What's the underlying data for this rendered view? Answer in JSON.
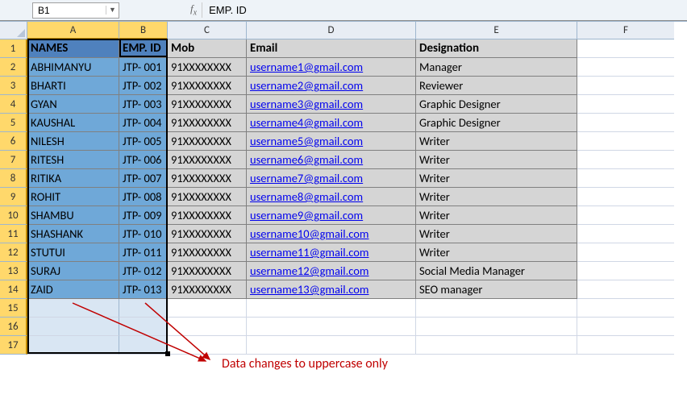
{
  "nameBox": "B1",
  "formulaValue": "EMP. ID",
  "columns": [
    "A",
    "B",
    "C",
    "D",
    "E",
    "F"
  ],
  "headerRow": {
    "A": "NAMES",
    "B": "EMP. ID",
    "C": "Mob",
    "D": "Email",
    "E": "Designation"
  },
  "rows": [
    {
      "n": 2,
      "a": "ABHIMANYU",
      "b": "JTP- 001",
      "c": "91XXXXXXXX",
      "d": "username1@gmail.com",
      "e": "Manager"
    },
    {
      "n": 3,
      "a": "BHARTI",
      "b": "JTP- 002",
      "c": "91XXXXXXXX",
      "d": "username2@gmail.com",
      "e": "Reviewer"
    },
    {
      "n": 4,
      "a": "GYAN",
      "b": "JTP- 003",
      "c": "91XXXXXXXX",
      "d": "username3@gmail.com",
      "e": "Graphic Designer"
    },
    {
      "n": 5,
      "a": "KAUSHAL",
      "b": "JTP- 004",
      "c": "91XXXXXXXX",
      "d": "username4@gmail.com",
      "e": "Graphic Designer"
    },
    {
      "n": 6,
      "a": "NILESH",
      "b": "JTP- 005",
      "c": "91XXXXXXXX",
      "d": "username5@gmail.com",
      "e": "Writer"
    },
    {
      "n": 7,
      "a": "RITESH",
      "b": "JTP- 006",
      "c": "91XXXXXXXX",
      "d": "username6@gmail.com",
      "e": "Writer"
    },
    {
      "n": 8,
      "a": "RITIKA",
      "b": "JTP- 007",
      "c": "91XXXXXXXX",
      "d": "username7@gmail.com",
      "e": "Writer"
    },
    {
      "n": 9,
      "a": "ROHIT",
      "b": "JTP- 008",
      "c": "91XXXXXXXX",
      "d": "username8@gmail.com",
      "e": "Writer"
    },
    {
      "n": 10,
      "a": "SHAMBU",
      "b": "JTP- 009",
      "c": "91XXXXXXXX",
      "d": "username9@gmail.com",
      "e": "Writer"
    },
    {
      "n": 11,
      "a": "SHASHANK",
      "b": "JTP- 010",
      "c": "91XXXXXXXX",
      "d": "username10@gmail.com",
      "e": "Writer"
    },
    {
      "n": 12,
      "a": "STUTUI",
      "b": "JTP- 011",
      "c": "91XXXXXXXX",
      "d": "username11@gmail.com",
      "e": "Writer"
    },
    {
      "n": 13,
      "a": "SURAJ",
      "b": "JTP- 012",
      "c": "91XXXXXXXX",
      "d": "username12@gmail.com",
      "e": "Social Media Manager"
    },
    {
      "n": 14,
      "a": "ZAID",
      "b": "JTP- 013",
      "c": "91XXXXXXXX",
      "d": "username13@gmail.com",
      "e": "SEO manager"
    }
  ],
  "emptyRows": [
    15,
    16,
    17
  ],
  "annotationText": "Data changes to uppercase only",
  "chart_data": {
    "type": "table",
    "title": "",
    "columns": [
      "NAMES",
      "EMP. ID",
      "Mob",
      "Email",
      "Designation"
    ],
    "data": [
      [
        "ABHIMANYU",
        "JTP- 001",
        "91XXXXXXXX",
        "username1@gmail.com",
        "Manager"
      ],
      [
        "BHARTI",
        "JTP- 002",
        "91XXXXXXXX",
        "username2@gmail.com",
        "Reviewer"
      ],
      [
        "GYAN",
        "JTP- 003",
        "91XXXXXXXX",
        "username3@gmail.com",
        "Graphic Designer"
      ],
      [
        "KAUSHAL",
        "JTP- 004",
        "91XXXXXXXX",
        "username4@gmail.com",
        "Graphic Designer"
      ],
      [
        "NILESH",
        "JTP- 005",
        "91XXXXXXXX",
        "username5@gmail.com",
        "Writer"
      ],
      [
        "RITESH",
        "JTP- 006",
        "91XXXXXXXX",
        "username6@gmail.com",
        "Writer"
      ],
      [
        "RITIKA",
        "JTP- 007",
        "91XXXXXXXX",
        "username7@gmail.com",
        "Writer"
      ],
      [
        "ROHIT",
        "JTP- 008",
        "91XXXXXXXX",
        "username8@gmail.com",
        "Writer"
      ],
      [
        "SHAMBU",
        "JTP- 009",
        "91XXXXXXXX",
        "username9@gmail.com",
        "Writer"
      ],
      [
        "SHASHANK",
        "JTP- 010",
        "91XXXXXXXX",
        "username10@gmail.com",
        "Writer"
      ],
      [
        "STUTUI",
        "JTP- 011",
        "91XXXXXXXX",
        "username11@gmail.com",
        "Writer"
      ],
      [
        "SURAJ",
        "JTP- 012",
        "91XXXXXXXX",
        "username12@gmail.com",
        "Social Media Manager"
      ],
      [
        "ZAID",
        "JTP- 013",
        "91XXXXXXXX",
        "username13@gmail.com",
        "SEO manager"
      ]
    ]
  }
}
